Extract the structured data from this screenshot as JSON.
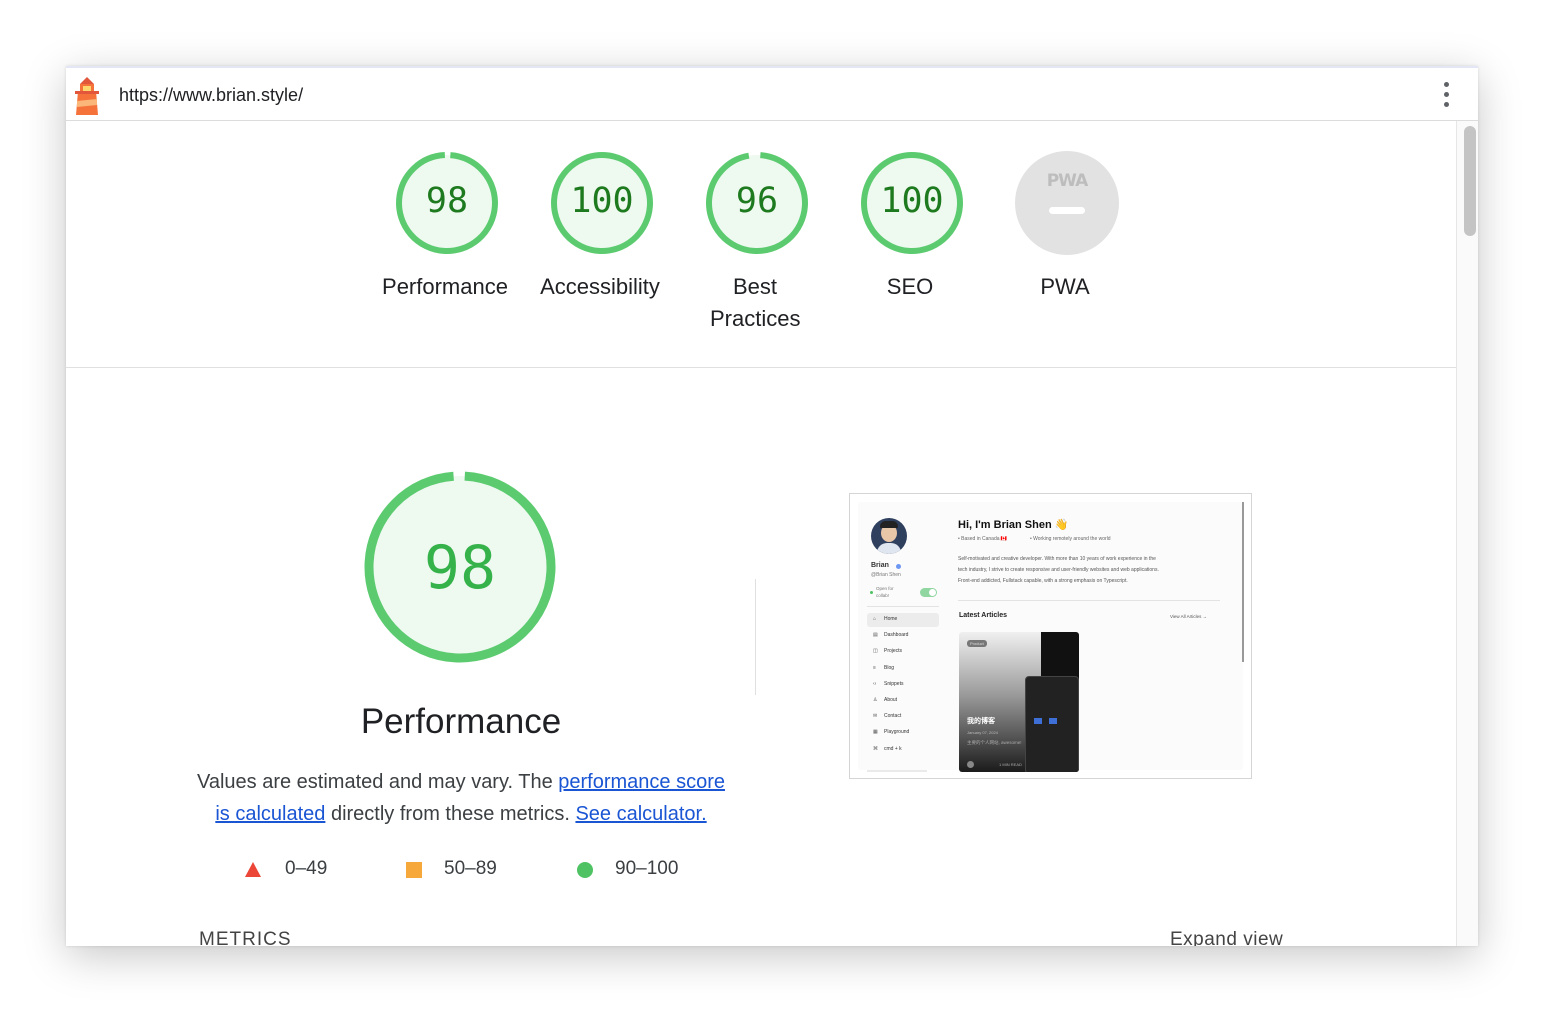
{
  "header": {
    "url": "https://www.brian.style/",
    "logo_icon": "lighthouse-icon",
    "menu_icon": "kebab-menu-icon"
  },
  "gauges": [
    {
      "score": "98",
      "label": "Performance",
      "fraction": 0.98
    },
    {
      "score": "100",
      "label": "Accessibility",
      "fraction": 1.0
    },
    {
      "score": "96",
      "label": "Best Practices",
      "fraction": 0.96
    },
    {
      "score": "100",
      "label": "SEO",
      "fraction": 1.0
    },
    {
      "score": "",
      "label": "PWA",
      "badge": "PWA",
      "fraction": 0
    }
  ],
  "performance": {
    "score": "98",
    "fraction": 0.98,
    "title": "Performance",
    "desc_prefix": "Values are estimated and may vary. The ",
    "desc_link1": "performance score is calculated",
    "desc_middle": " directly from these metrics. ",
    "desc_link2": "See calculator."
  },
  "legend": {
    "fail": "0–49",
    "average": "50–89",
    "pass": "90–100"
  },
  "screenshot": {
    "greeting": "Hi, I'm Brian Shen 👋",
    "location": "• Based in Canada 🇨🇦",
    "remote": "• Working remotely around the world",
    "bio1": "Self-motivated and creative developer. With more than 10 years of work experience in the",
    "bio2": "tech industry, I strive to create responsive and user-friendly websites and web applications.",
    "bio3": "Front-end addicted, Fullstack capable, with a strong emphasis on Typescript.",
    "name": "Brian",
    "handle": "@Brian Shen",
    "open_for": "Open for",
    "collab": "collab!",
    "nav": [
      "Home",
      "Dashboard",
      "Projects",
      "Blog",
      "Snippets",
      "About",
      "Contact",
      "Playground",
      "cmd + k"
    ],
    "latest": "Latest Articles",
    "view_all": "View All Articles →",
    "tag": "Product",
    "card_title": "我的博客",
    "card_date": "January 07, 2024",
    "card_desc": "主要的个人网站, awesome!",
    "card_read": "1 MIN READ"
  },
  "footer": {
    "metrics": "METRICS",
    "expand": "Expand view"
  },
  "colors": {
    "pass": "#0cce6b",
    "pass_text": "#1e7a1e",
    "average": "#ffa400",
    "fail": "#ff4e42",
    "link": "#1a55d4"
  }
}
